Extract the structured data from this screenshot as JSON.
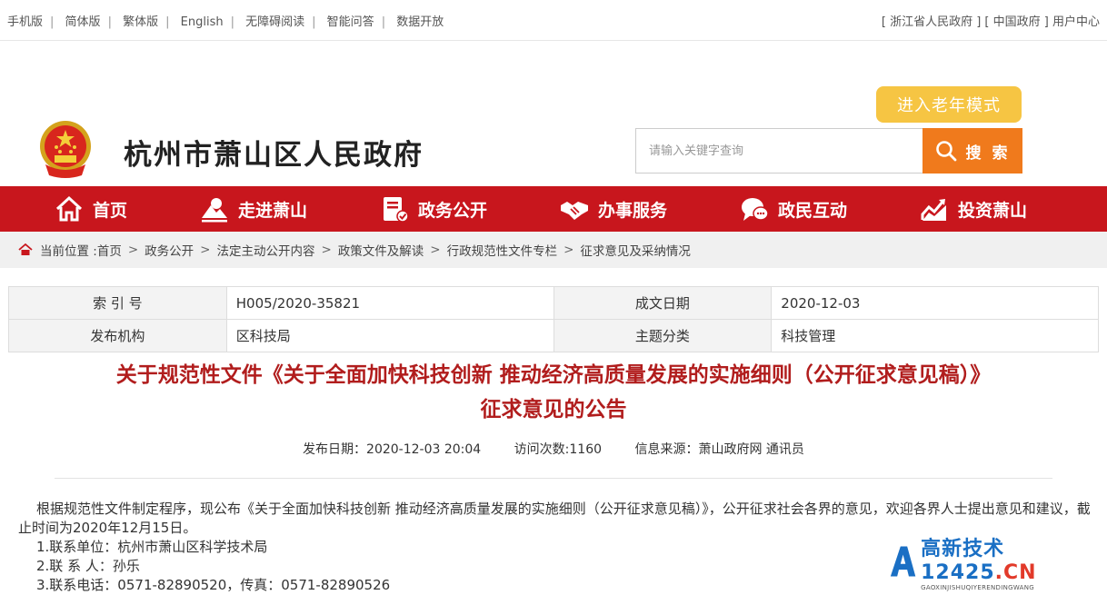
{
  "topbar": {
    "left_links": [
      "手机版",
      "简体版",
      "繁体版",
      "English",
      "无障碍阅读",
      "智能问答",
      "数据开放"
    ],
    "right_links": [
      "浙江省人民政府",
      "中国政府",
      "用户中心"
    ]
  },
  "header": {
    "site_title": "杭州市萧山区人民政府",
    "elder_mode_label": "进入老年模式",
    "search_placeholder": "请输入关键字查询",
    "search_label": "搜 索"
  },
  "nav": {
    "items": [
      {
        "label": "首页",
        "icon": "home-icon"
      },
      {
        "label": "走进萧山",
        "icon": "mountain-icon"
      },
      {
        "label": "政务公开",
        "icon": "document-icon"
      },
      {
        "label": "办事服务",
        "icon": "handshake-icon"
      },
      {
        "label": "政民互动",
        "icon": "chat-icon"
      },
      {
        "label": "投资萧山",
        "icon": "chart-icon"
      }
    ]
  },
  "breadcrumb": {
    "prefix": "当前位置 :",
    "items": [
      "首页",
      "政务公开",
      "法定主动公开内容",
      "政策文件及解读",
      "行政规范性文件专栏",
      "征求意见及采纳情况"
    ]
  },
  "meta": {
    "index_label": "索 引 号",
    "index_value": "H005/2020-35821",
    "date_label": "成文日期",
    "date_value": "2020-12-03",
    "org_label": "发布机构",
    "org_value": "区科技局",
    "topic_label": "主题分类",
    "topic_value": "科技管理"
  },
  "article": {
    "title_line1": "关于规范性文件《关于全面加快科技创新 推动经济高质量发展的实施细则（公开征求意见稿）》",
    "title_line2": "征求意见的公告",
    "publish_date": "发布日期：2020-12-03 20:04",
    "visits": "访问次数:1160",
    "source": "信息来源：萧山政府网 通讯员",
    "paragraph": "根据规范性文件制定程序，现公布《关于全面加快科技创新 推动经济高质量发展的实施细则（公开征求意见稿）》，公开征求社会各界的意见，欢迎各界人士提出意见和建议，截止时间为2020年12月15日。",
    "item1": "1.联系单位：杭州市萧山区科学技术局",
    "item2": "2.联 系 人：孙乐",
    "item3": "3.联系电话：0571-82890520，传真：0571-82890526"
  },
  "watermark": {
    "main": "高新技术",
    "num": "12425",
    "cn": ".CN",
    "sub": "GAOXINJISHUQIYERENDINGWANG"
  },
  "colors": {
    "nav_red": "#c8161d",
    "title_red": "#b11d1d",
    "search_orange": "#f07a1c",
    "elder_yellow": "#f6c543"
  }
}
